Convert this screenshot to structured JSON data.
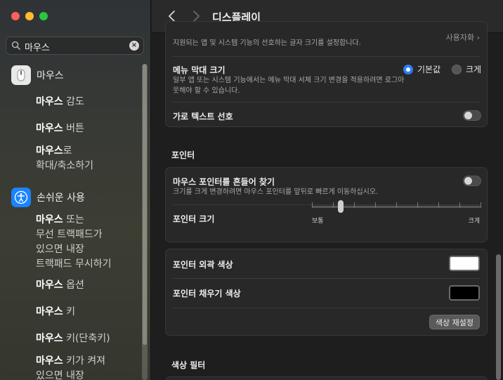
{
  "search": {
    "query": "마우스"
  },
  "sidebar": {
    "sections": [
      {
        "label": "마우스",
        "icon": "mouse-icon",
        "color": "#e8e8e8"
      },
      {
        "label": "손쉬운 사용",
        "icon": "accessibility-icon",
        "color": "#1a84ff"
      }
    ],
    "items": [
      {
        "bold": "마우스",
        "rest": " 감도"
      },
      {
        "bold": "마우스",
        "rest": " 버튼"
      },
      {
        "bold": "마우스",
        "rest": "로",
        "line2": "확대/축소하기"
      },
      {
        "bold": "마우스",
        "rest": " 또는",
        "line2": "무선 트랙패드가",
        "line3": "있으면 내장",
        "line4": "트랙패드 무시하기"
      },
      {
        "bold": "마우스",
        "rest": " 옵션"
      },
      {
        "bold": "마우스",
        "rest": " 키"
      },
      {
        "bold": "마우스",
        "rest": " 키(단축키)"
      },
      {
        "bold": "마우스",
        "rest": " 키가 켜져",
        "line2": "있으면 내장"
      }
    ]
  },
  "header": {
    "title": "디스플레이"
  },
  "text_card": {
    "top_sub": "지원되는 앱 및 시스템 기능의 선호하는 글자 크기를 설정합니다.",
    "top_value": "사용자화",
    "menubar_title": "메뉴 막대 크기",
    "menubar_sub": "일부 앱 또는 시스템 기능에서는 메뉴 막대 서체 크기 변경을 적용하려면 로그아웃해야 할 수 있습니다.",
    "radio_default": "기본값",
    "radio_large": "크게",
    "horizontal_text": "가로 텍스트 선호"
  },
  "pointer": {
    "section": "포인터",
    "shake_title": "마우스 포인터를 흔들어 찾기",
    "shake_sub": "크기를 크게 변경하려면 마우스 포인터를 앞뒤로 빠르게 이동하십시오.",
    "size_title": "포인터 크기",
    "size_min": "보통",
    "size_max": "크게",
    "size_level_fraction": 0.17
  },
  "colors": {
    "outline_title": "포인터 외곽 색상",
    "outline_color": "#ffffff",
    "fill_title": "포인터 채우기 색상",
    "fill_color": "#000000",
    "reset_button": "색상 재설정"
  },
  "color_filter": {
    "section": "색상 필터"
  }
}
